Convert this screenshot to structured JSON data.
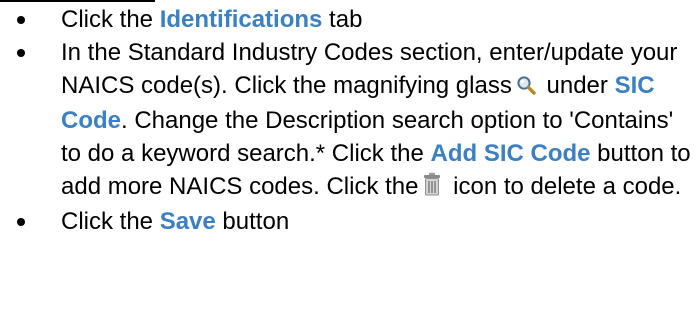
{
  "colors": {
    "highlight": "#3b7fc4",
    "text": "#000000"
  },
  "icons": [
    "magnifying-glass-icon",
    "trash-can-icon"
  ],
  "steps": [
    {
      "a": "Click the ",
      "hl1": "Identifications",
      "b": " tab"
    },
    {
      "a": "In the Standard Industry Codes section, enter/update your NAICS code(s). Click the magnifying glass",
      "b": " under ",
      "hl1": "SIC Code",
      "c": ". Change the Description search option to 'Contains' to do a keyword search.* Click the ",
      "hl2": "Add SIC Code",
      "d": " button to add more NAICS codes. Click the",
      "e": " icon to delete a code."
    },
    {
      "a": "Click the ",
      "hl1": "Save",
      "b": " button"
    }
  ]
}
